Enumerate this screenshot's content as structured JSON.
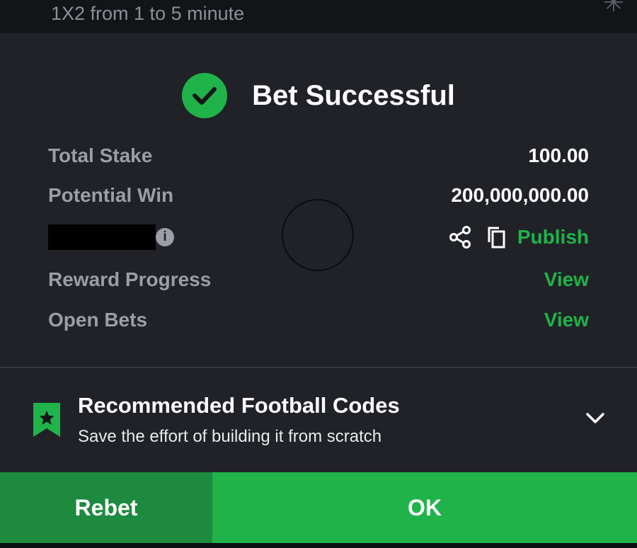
{
  "market_title": "1X2 from 1 to 5 minute",
  "header": {
    "title": "Bet Successful"
  },
  "details": {
    "total_stake_label": "Total Stake",
    "total_stake_value": "100.00",
    "potential_win_label": "Potential Win",
    "potential_win_value": "200,000,000.00",
    "info_glyph": "i",
    "publish_label": "Publish",
    "reward_progress_label": "Reward Progress",
    "reward_progress_link": "View",
    "open_bets_label": "Open Bets",
    "open_bets_link": "View"
  },
  "promo": {
    "title": "Recommended Football Codes",
    "subtitle": "Save the effort of building it from scratch"
  },
  "buttons": {
    "rebet": "Rebet",
    "ok": "OK"
  },
  "icons": [
    "check-icon",
    "info-icon",
    "share-icon",
    "copy-icon",
    "bookmark-star-icon",
    "chevron-down-icon"
  ],
  "colors": {
    "accent": "#1fb34a",
    "accent_dark": "#1d8a3f",
    "background": "#202227"
  }
}
